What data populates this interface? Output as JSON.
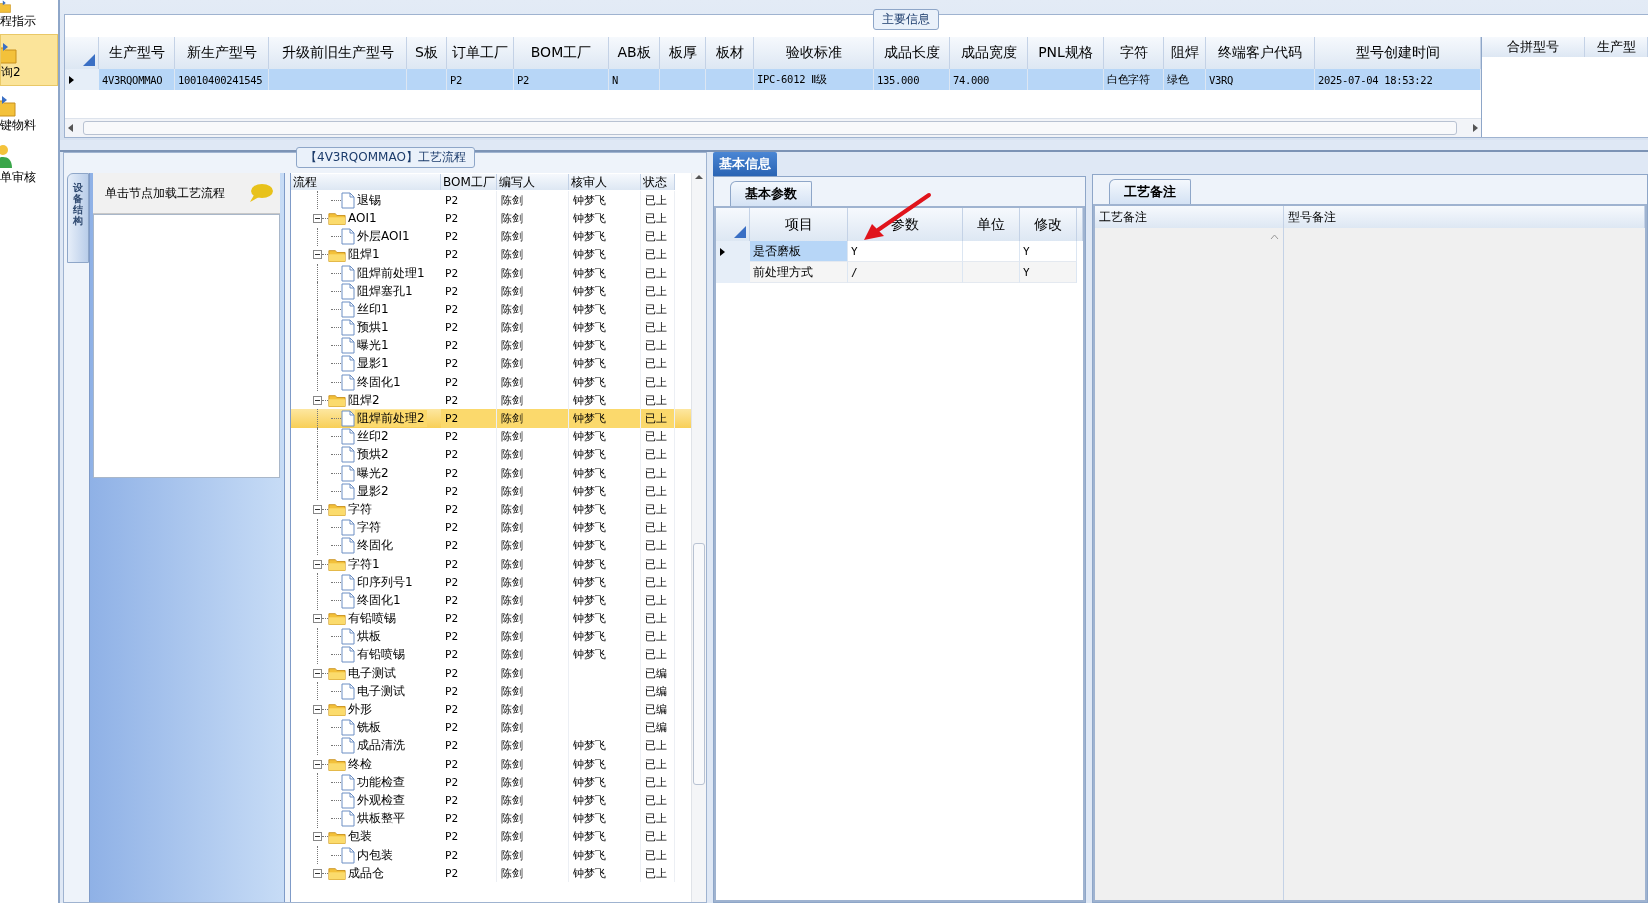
{
  "sidebar": {
    "items": [
      {
        "label": "程指示",
        "kind": "folder",
        "selected": false
      },
      {
        "label": "询2",
        "kind": "folder",
        "selected": true
      },
      {
        "label": "键物料",
        "kind": "folder",
        "selected": false
      },
      {
        "label": "单审核",
        "kind": "person",
        "selected": false
      }
    ]
  },
  "main_info": {
    "title": "主要信息",
    "columns": [
      "生产型号",
      "新生产型号",
      "升级前旧生产型号",
      "S板",
      "订单工厂",
      "BOM工厂",
      "AB板",
      "板厚",
      "板材",
      "验收标准",
      "成品长度",
      "成品宽度",
      "PNL规格",
      "字符",
      "阻焊",
      "终端客户代码",
      "型号创建时间"
    ],
    "rows": [
      {
        "selected": true,
        "cells": [
          "4V3RQOMMAO",
          "10010400241545",
          null,
          null,
          "P2",
          "P2",
          "N",
          null,
          null,
          "IPC-6012 Ⅱ级",
          "135.000",
          "74.000",
          null,
          "白色字符",
          "绿色",
          "V3RQ",
          "2025-07-04 18:53:22"
        ]
      }
    ],
    "side_columns": [
      "合拼型号",
      "生产型"
    ]
  },
  "process": {
    "title": "【4V3RQOMMAO】工艺流程",
    "side_tab": "设备结构",
    "hint": "单击节点加载工艺流程",
    "columns": [
      "流程",
      "BOM工厂",
      "编写人",
      "核审人",
      "状态"
    ],
    "nodes": [
      {
        "children": [
          {
            "label": "退锡",
            "bom": "P2",
            "writer": "陈剑",
            "reviewer": "钟梦飞",
            "status": "已上",
            "selected": false
          }
        ]
      },
      {
        "label": "AOI1",
        "bom": "P2",
        "writer": "陈剑",
        "reviewer": "钟梦飞",
        "status": "已上",
        "selected": false,
        "children": [
          {
            "label": "外层AOI1",
            "bom": "P2",
            "writer": "陈剑",
            "reviewer": "钟梦飞",
            "status": "已上",
            "selected": false
          }
        ]
      },
      {
        "label": "阻焊1",
        "bom": "P2",
        "writer": "陈剑",
        "reviewer": "钟梦飞",
        "status": "已上",
        "selected": false,
        "children": [
          {
            "label": "阻焊前处理1",
            "bom": "P2",
            "writer": "陈剑",
            "reviewer": "钟梦飞",
            "status": "已上",
            "selected": false
          },
          {
            "label": "阻焊塞孔1",
            "bom": "P2",
            "writer": "陈剑",
            "reviewer": "钟梦飞",
            "status": "已上",
            "selected": false
          },
          {
            "label": "丝印1",
            "bom": "P2",
            "writer": "陈剑",
            "reviewer": "钟梦飞",
            "status": "已上",
            "selected": false
          },
          {
            "label": "预烘1",
            "bom": "P2",
            "writer": "陈剑",
            "reviewer": "钟梦飞",
            "status": "已上",
            "selected": false
          },
          {
            "label": "曝光1",
            "bom": "P2",
            "writer": "陈剑",
            "reviewer": "钟梦飞",
            "status": "已上",
            "selected": false
          },
          {
            "label": "显影1",
            "bom": "P2",
            "writer": "陈剑",
            "reviewer": "钟梦飞",
            "status": "已上",
            "selected": false
          },
          {
            "label": "终固化1",
            "bom": "P2",
            "writer": "陈剑",
            "reviewer": "钟梦飞",
            "status": "已上",
            "selected": false
          }
        ]
      },
      {
        "label": "阻焊2",
        "bom": "P2",
        "writer": "陈剑",
        "reviewer": "钟梦飞",
        "status": "已上",
        "selected": false,
        "children": [
          {
            "label": "阻焊前处理2",
            "bom": "P2",
            "writer": "陈剑",
            "reviewer": "钟梦飞",
            "status": "已上",
            "selected": true
          },
          {
            "label": "丝印2",
            "bom": "P2",
            "writer": "陈剑",
            "reviewer": "钟梦飞",
            "status": "已上",
            "selected": false
          },
          {
            "label": "预烘2",
            "bom": "P2",
            "writer": "陈剑",
            "reviewer": "钟梦飞",
            "status": "已上",
            "selected": false
          },
          {
            "label": "曝光2",
            "bom": "P2",
            "writer": "陈剑",
            "reviewer": "钟梦飞",
            "status": "已上",
            "selected": false
          },
          {
            "label": "显影2",
            "bom": "P2",
            "writer": "陈剑",
            "reviewer": "钟梦飞",
            "status": "已上",
            "selected": false
          }
        ]
      },
      {
        "label": "字符",
        "bom": "P2",
        "writer": "陈剑",
        "reviewer": "钟梦飞",
        "status": "已上",
        "selected": false,
        "children": [
          {
            "label": "字符",
            "bom": "P2",
            "writer": "陈剑",
            "reviewer": "钟梦飞",
            "status": "已上",
            "selected": false
          },
          {
            "label": "终固化",
            "bom": "P2",
            "writer": "陈剑",
            "reviewer": "钟梦飞",
            "status": "已上",
            "selected": false
          }
        ]
      },
      {
        "label": "字符1",
        "bom": "P2",
        "writer": "陈剑",
        "reviewer": "钟梦飞",
        "status": "已上",
        "selected": false,
        "children": [
          {
            "label": "印序列号1",
            "bom": "P2",
            "writer": "陈剑",
            "reviewer": "钟梦飞",
            "status": "已上",
            "selected": false
          },
          {
            "label": "终固化1",
            "bom": "P2",
            "writer": "陈剑",
            "reviewer": "钟梦飞",
            "status": "已上",
            "selected": false
          }
        ]
      },
      {
        "label": "有铅喷锡",
        "bom": "P2",
        "writer": "陈剑",
        "reviewer": "钟梦飞",
        "status": "已上",
        "selected": false,
        "children": [
          {
            "label": "烘板",
            "bom": "P2",
            "writer": "陈剑",
            "reviewer": "钟梦飞",
            "status": "已上",
            "selected": false
          },
          {
            "label": "有铅喷锡",
            "bom": "P2",
            "writer": "陈剑",
            "reviewer": "钟梦飞",
            "status": "已上",
            "selected": false
          }
        ]
      },
      {
        "label": "电子测试",
        "bom": "P2",
        "writer": "陈剑",
        "status": "已编",
        "selected": false,
        "children": [
          {
            "label": "电子测试",
            "bom": "P2",
            "writer": "陈剑",
            "status": "已编",
            "selected": false
          }
        ]
      },
      {
        "label": "外形",
        "bom": "P2",
        "writer": "陈剑",
        "status": "已编",
        "selected": false,
        "children": [
          {
            "label": "铣板",
            "bom": "P2",
            "writer": "陈剑",
            "status": "已编",
            "selected": false
          },
          {
            "label": "成品清洗",
            "bom": "P2",
            "writer": "陈剑",
            "reviewer": "钟梦飞",
            "status": "已上",
            "selected": false
          }
        ]
      },
      {
        "label": "终检",
        "bom": "P2",
        "writer": "陈剑",
        "reviewer": "钟梦飞",
        "status": "已上",
        "selected": false,
        "children": [
          {
            "label": "功能检查",
            "bom": "P2",
            "writer": "陈剑",
            "reviewer": "钟梦飞",
            "status": "已上",
            "selected": false
          },
          {
            "label": "外观检查",
            "bom": "P2",
            "writer": "陈剑",
            "reviewer": "钟梦飞",
            "status": "已上",
            "selected": false
          },
          {
            "label": "烘板整平",
            "bom": "P2",
            "writer": "陈剑",
            "reviewer": "钟梦飞",
            "status": "已上",
            "selected": false
          }
        ]
      },
      {
        "label": "包装",
        "bom": "P2",
        "writer": "陈剑",
        "reviewer": "钟梦飞",
        "status": "已上",
        "selected": false,
        "children": [
          {
            "label": "内包装",
            "bom": "P2",
            "writer": "陈剑",
            "reviewer": "钟梦飞",
            "status": "已上",
            "selected": false
          }
        ]
      },
      {
        "label": "成品仓",
        "bom": "P2",
        "writer": "陈剑",
        "reviewer": "钟梦飞",
        "status": "已上",
        "selected": false
      }
    ]
  },
  "basic": {
    "tab": "基本信息",
    "subtab": "基本参数",
    "columns": [
      "项目",
      "参数",
      "单位",
      "修改"
    ],
    "rows": [
      {
        "selected": true,
        "cells": [
          "是否磨板",
          "Y",
          null,
          "Y"
        ]
      },
      {
        "selected": false,
        "cells": [
          "前处理方式",
          "/",
          null,
          "Y"
        ]
      }
    ]
  },
  "notes": {
    "tab": "工艺备注",
    "columns": [
      "工艺备注",
      "型号备注"
    ]
  }
}
